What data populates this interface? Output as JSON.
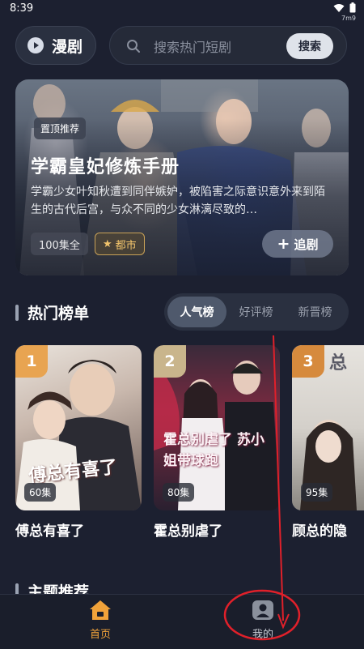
{
  "status_bar": {
    "time": "8:39",
    "sub_label": "7m9"
  },
  "header": {
    "mode_label": "漫剧",
    "search": {
      "placeholder": "搜索热门短剧",
      "value": "",
      "button_label": "搜索"
    }
  },
  "banner": {
    "tag": "置顶推荐",
    "title": "学霸皇妃修炼手册",
    "description": "学霸少女叶知秋遭到同伴嫉妒，被陷害之际意识意外来到陌生的古代后宫，与众不同的少女淋漓尽致的…",
    "episodes": "100集全",
    "genre": "都市",
    "follow_label": "追剧"
  },
  "hot_list": {
    "title": "热门榜单",
    "tabs": [
      {
        "label": "人气榜",
        "active": true
      },
      {
        "label": "好评榜",
        "active": false
      },
      {
        "label": "新晋榜",
        "active": false
      }
    ],
    "items": [
      {
        "rank": "1",
        "name": "傅总有喜了",
        "episodes": "60集",
        "poster_text": "傅总有喜了",
        "badge_color": "#e8a451"
      },
      {
        "rank": "2",
        "name": "霍总别虐了",
        "episodes": "80集",
        "poster_text": "霍总别虐了 苏小姐带球跑",
        "badge_color": "#c9b58c"
      },
      {
        "rank": "3",
        "name": "顾总的隐",
        "episodes": "95集",
        "poster_text": "总",
        "badge_color": "#d68a3d"
      }
    ]
  },
  "theme_section": {
    "title": "主题推荐"
  },
  "bottom_nav": [
    {
      "label": "首页",
      "icon": "home-icon",
      "active": true
    },
    {
      "label": "我的",
      "icon": "profile-icon",
      "active": false
    }
  ],
  "colors": {
    "background": "#1c2030",
    "accent": "#f0a23a",
    "annotation": "#e0202a"
  }
}
